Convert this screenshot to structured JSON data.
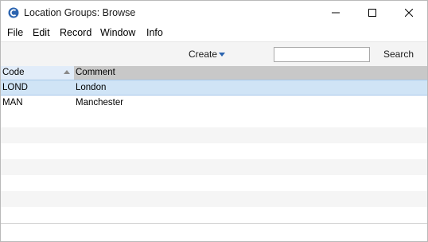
{
  "window": {
    "title": "Location Groups: Browse",
    "controls": {
      "minimize": "minimize-icon",
      "maximize": "maximize-icon",
      "close": "close-icon"
    }
  },
  "menu": {
    "items": [
      "File",
      "Edit",
      "Record",
      "Window",
      "Info"
    ]
  },
  "toolbar": {
    "create_label": "Create",
    "search_value": "",
    "search_label": "Search"
  },
  "table": {
    "columns": [
      "Code",
      "Comment"
    ],
    "sort": {
      "column": "Code",
      "direction": "ascending"
    },
    "rows": [
      {
        "code": "LOND",
        "comment": "London",
        "selected": true
      },
      {
        "code": "MAN",
        "comment": "Manchester",
        "selected": false
      }
    ]
  },
  "colors": {
    "accent": "#2b64b0",
    "selection": "#d0e4f6",
    "header": "#c8c8c8"
  }
}
